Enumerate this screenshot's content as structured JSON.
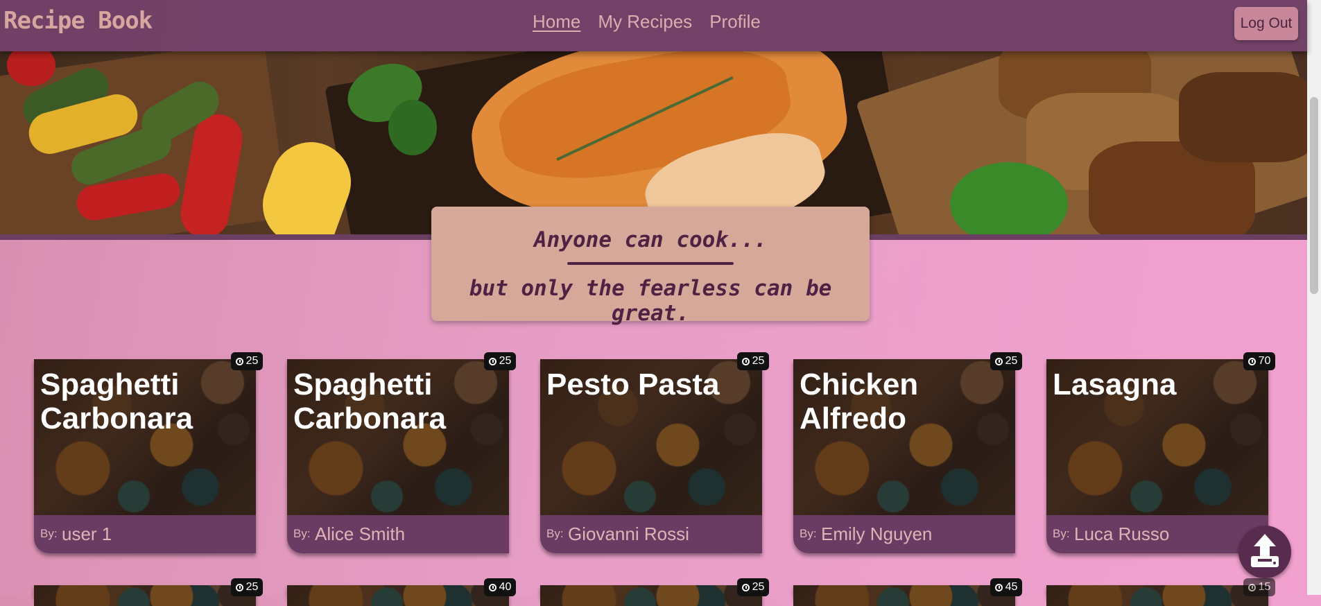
{
  "brand": "Recipe Book",
  "nav": {
    "links": [
      "Home",
      "My Recipes",
      "Profile"
    ],
    "active": "Home",
    "logout_label": "Log Out"
  },
  "quote": {
    "line1": "Anyone can cook...",
    "line2": "but only the fearless can be great."
  },
  "recipes": [
    {
      "title": "Spaghetti Carbonara",
      "by_label": "By:",
      "author": "user 1",
      "time": "25"
    },
    {
      "title": "Spaghetti Carbonara",
      "by_label": "By:",
      "author": "Alice Smith",
      "time": "25"
    },
    {
      "title": "Pesto Pasta",
      "by_label": "By:",
      "author": "Giovanni Rossi",
      "time": "25"
    },
    {
      "title": "Chicken Alfredo",
      "by_label": "By:",
      "author": "Emily Nguyen",
      "time": "25"
    },
    {
      "title": "Lasagna",
      "by_label": "By:",
      "author": "Luca Russo",
      "time": "70"
    }
  ],
  "recipes_row2_times": [
    "25",
    "40",
    "25",
    "45",
    "15"
  ],
  "icons": {
    "clock": "clock-icon",
    "upload": "upload-icon"
  },
  "colors": {
    "navbar": "#673a60",
    "brand_text": "#d7a79f",
    "quote_bg": "#d6a89a",
    "quote_text": "#4f2244",
    "card_footer": "#6b3c63",
    "fab": "#582c4e"
  }
}
